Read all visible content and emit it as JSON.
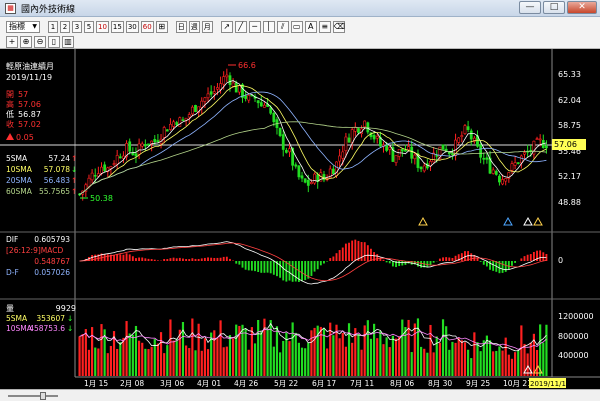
{
  "window": {
    "title": "國內外技術線",
    "app_icon": "chart-app-icon",
    "controls": [
      "—",
      "□",
      "✕"
    ]
  },
  "toolbar": {
    "period_dropdown": "指標",
    "buttons_row1": [
      "1",
      "2",
      "3",
      "5",
      "10",
      "15",
      "30",
      "60"
    ],
    "buttons_row1_red": [
      "10",
      "60"
    ],
    "buttons_row2": [
      "日",
      "週",
      "月"
    ]
  },
  "info": {
    "name": "輕原油連續月",
    "date": "2019/11/19",
    "open_label": "開",
    "open_value": "57",
    "high_label": "高",
    "high_value": "57.06",
    "low_label": "低",
    "low_value": "56.87",
    "close_label": "收",
    "close_value": "57.02",
    "change": "0.05",
    "ma": [
      {
        "label": "5SMA",
        "value": "57.24",
        "arrow": "↑",
        "color": "#ffffff"
      },
      {
        "label": "10SMA",
        "value": "57.078",
        "arrow": "↓",
        "color": "#ffff66"
      },
      {
        "label": "20SMA",
        "value": "56.483",
        "arrow": "↑",
        "color": "#8fb4ff"
      },
      {
        "label": "60SMA",
        "value": "55.7565",
        "arrow": "↑",
        "color": "#b3d48a"
      }
    ]
  },
  "macd": {
    "dif_label": "DIF",
    "dif_value": "0.605793",
    "macd_label": "[26:12:9]MACD",
    "macd_value": "0.548767",
    "df_label": "D-F",
    "df_value": "0.057026",
    "zero_label": "0"
  },
  "volume": {
    "label": "量",
    "value": "9929",
    "sma5_label": "5SMA",
    "sma5_value": "353607",
    "sma5_arrow": "↓",
    "sma10_label": "10SMA",
    "sma10_value": "458753.6",
    "sma10_arrow": "↓"
  },
  "colors": {
    "up": "#ff2020",
    "down": "#22dd22",
    "sma5": "#ffffff",
    "sma10": "#ffff66",
    "sma20": "#8fb4ff",
    "sma60": "#b3d48a",
    "volume_up": "#ff2020",
    "volume_down": "#22dd22"
  },
  "chart_data": {
    "type": "candlestick",
    "price_axis": [
      "65.33",
      "62.04",
      "58.75",
      "55.46",
      "52.17",
      "48.88"
    ],
    "macd_axis": [
      "0"
    ],
    "volume_axis": [
      "1200000",
      "800000",
      "400000"
    ],
    "x_labels": [
      "1月 15",
      "2月 08",
      "3月 06",
      "4月 01",
      "4月 26",
      "5月 22",
      "6月 17",
      "7月 11",
      "8月 06",
      "8月 30",
      "9月 25",
      "10月 21"
    ],
    "current_date_label": "2019/11/19",
    "current_price_label": "57.06",
    "high_marker": "66.6",
    "low_marker": "50.38",
    "ylim": [
      46.5,
      68.0
    ],
    "price_path": [
      50.6,
      51.5,
      52.8,
      53.6,
      54.2,
      53.8,
      54.8,
      55.6,
      56.3,
      56.0,
      55.7,
      56.8,
      57.3,
      57.0,
      58.0,
      58.8,
      59.3,
      60.0,
      59.5,
      60.4,
      61.3,
      62.1,
      62.6,
      63.1,
      63.6,
      64.8,
      65.6,
      64.2,
      63.5,
      63.0,
      62.2,
      62.7,
      61.6,
      62.2,
      59.5,
      57.7,
      56.5,
      55.5,
      53.3,
      52.1,
      51.8,
      52.3,
      53.0,
      52.4,
      53.6,
      54.2,
      56.1,
      57.5,
      58.6,
      59.1,
      59.8,
      58.6,
      57.5,
      56.5,
      56.7,
      55.3,
      55.8,
      56.2,
      55.7,
      54.8,
      54.0,
      54.6,
      55.4,
      56.1,
      56.6,
      56.0,
      56.6,
      57.8,
      58.7,
      57.4,
      55.9,
      54.9,
      54.0,
      53.5,
      52.4,
      53.4,
      53.9,
      54.8,
      55.4,
      55.9,
      56.6,
      57.1,
      57.0
    ]
  }
}
